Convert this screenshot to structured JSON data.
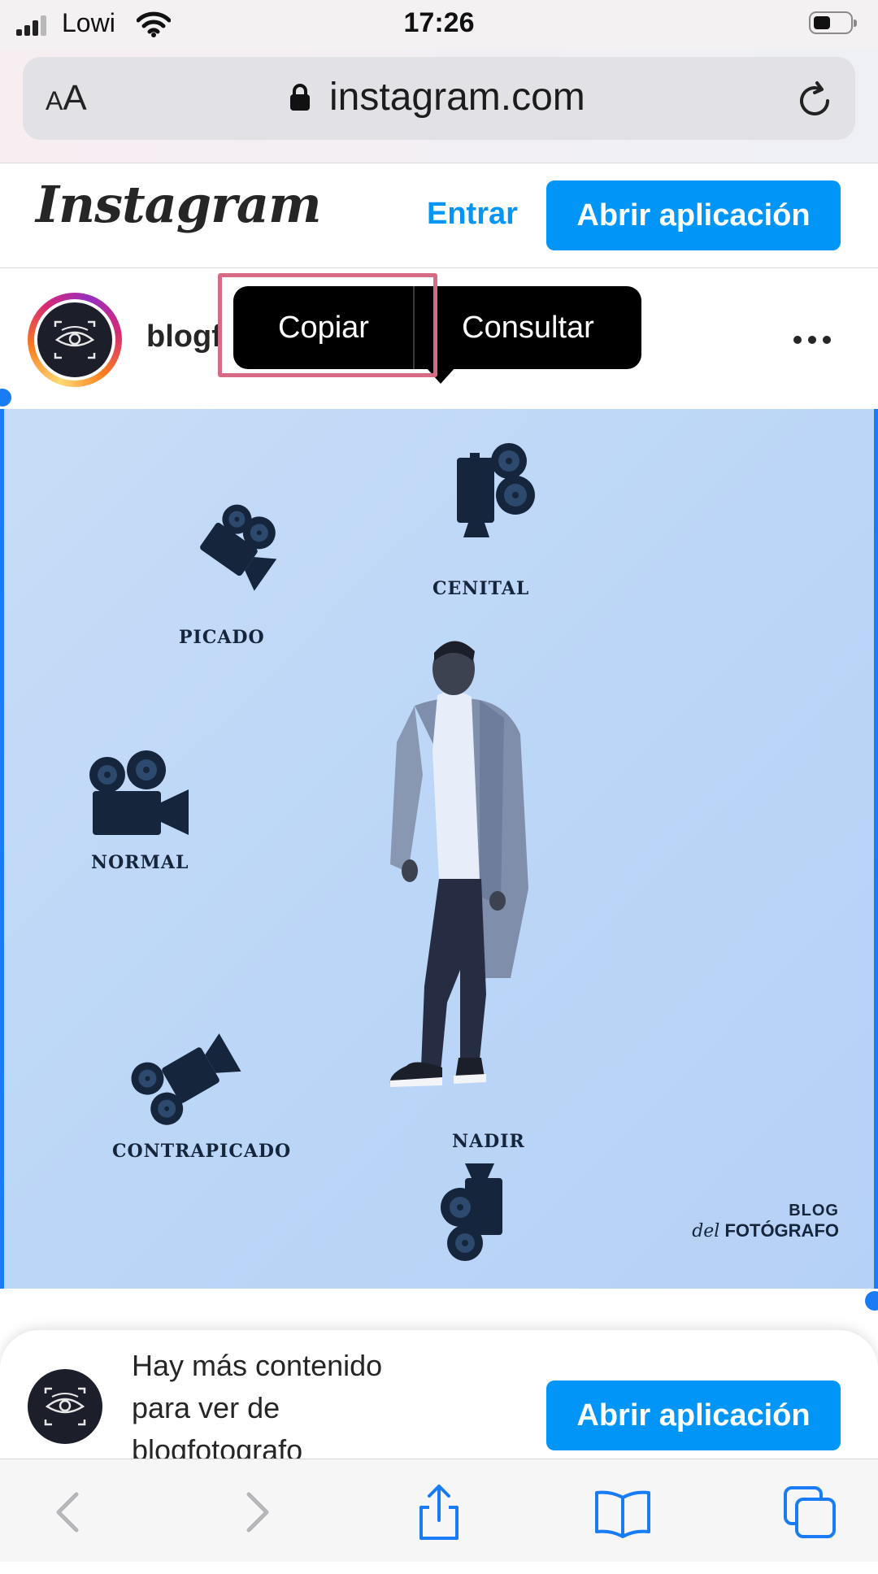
{
  "status_bar": {
    "carrier": "Lowi",
    "time": "17:26"
  },
  "browser": {
    "text_size_label_small": "A",
    "text_size_label_large": "A",
    "url": "instagram.com",
    "icons": [
      "lock-icon",
      "reload-icon"
    ]
  },
  "instagram_header": {
    "logo": "Instagram",
    "login_label": "Entrar",
    "open_app_label": "Abrir aplicación"
  },
  "post": {
    "username_visible": "blogf",
    "avatar_icon": "eye-icon"
  },
  "context_menu": {
    "copy_label": "Copiar",
    "lookup_label": "Consultar"
  },
  "post_image": {
    "labels": {
      "cenital": "CENITAL",
      "picado": "PICADO",
      "normal": "NORMAL",
      "contrapicado": "CONTRAPICADO",
      "nadir": "NADIR"
    },
    "watermark_line1": "BLOG",
    "watermark_line2_script": "del",
    "watermark_line2": "FOTÓGRAFO",
    "colors": {
      "background": "#bcd6f7",
      "ink": "#15253c"
    }
  },
  "bottom_sheet": {
    "line1": "Hay más contenido",
    "line2": "para ver de",
    "line3": "blogfotografo",
    "open_app_label": "Abrir aplicación"
  },
  "toolbar": {
    "icons": [
      "back-icon",
      "forward-icon",
      "share-icon",
      "bookmarks-icon",
      "tabs-icon"
    ]
  },
  "colors": {
    "accent": "#0095f6",
    "highlight": "#d76b86",
    "selection": "#1a7cf5"
  }
}
